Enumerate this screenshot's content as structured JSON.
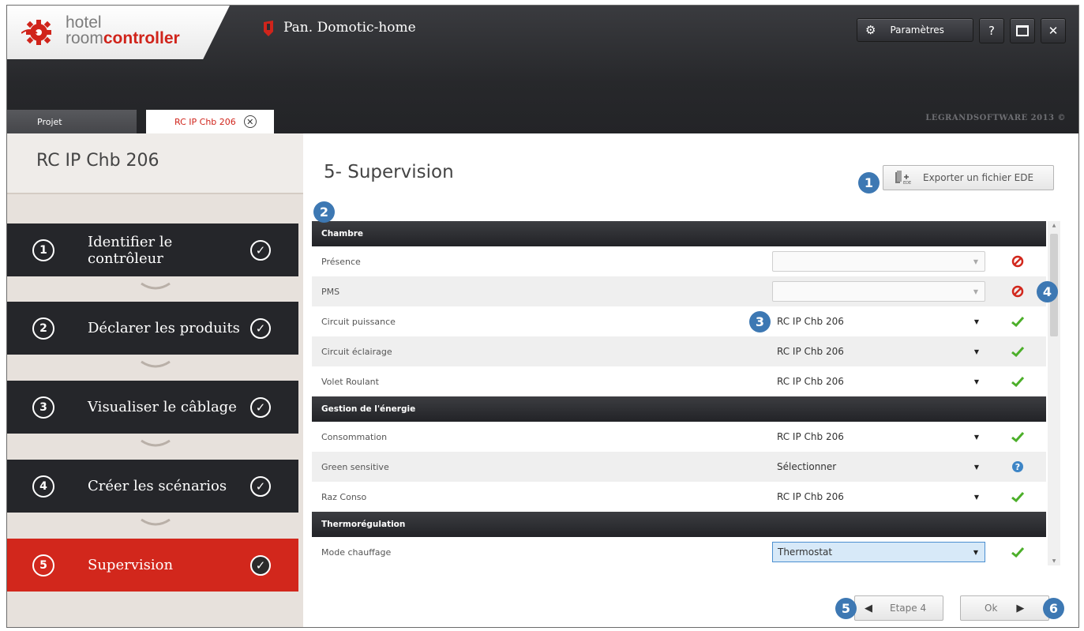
{
  "header": {
    "logo_hotel": "hotel",
    "logo_room": "room",
    "logo_controller": "controller",
    "app_title": "Pan. Domotic-home",
    "params_label": "Paramètres",
    "help_label": "?",
    "copyright": "LEGRANDSOFTWARE 2013 ©"
  },
  "tabs": [
    {
      "label": "Projet"
    },
    {
      "label": "RC IP Chb 206"
    }
  ],
  "sidebar": {
    "title": "RC IP Chb 206",
    "steps": [
      {
        "num": "1",
        "label": "Identifier le contrôleur"
      },
      {
        "num": "2",
        "label": "Déclarer les produits"
      },
      {
        "num": "3",
        "label": "Visualiser le câblage"
      },
      {
        "num": "4",
        "label": "Créer les scénarios"
      },
      {
        "num": "5",
        "label": "Supervision"
      }
    ]
  },
  "main": {
    "title": "5- Supervision",
    "export_label": "Exporter un fichier EDE",
    "sections": [
      {
        "title": "Chambre",
        "rows": [
          {
            "label": "Présence",
            "value": "",
            "status": "forbidden"
          },
          {
            "label": "PMS",
            "value": "",
            "status": "forbidden"
          },
          {
            "label": "Circuit puissance",
            "value": "RC IP Chb 206",
            "status": "ok"
          },
          {
            "label": "Circuit éclairage",
            "value": "RC IP Chb 206",
            "status": "ok"
          },
          {
            "label": "Volet Roulant",
            "value": "RC IP Chb 206",
            "status": "ok"
          }
        ]
      },
      {
        "title": "Gestion de l'énergie",
        "rows": [
          {
            "label": "Consommation",
            "value": "RC IP Chb 206",
            "status": "ok"
          },
          {
            "label": "Green sensitive",
            "value": "Sélectionner",
            "status": "help"
          },
          {
            "label": "Raz Conso",
            "value": "RC IP Chb 206",
            "status": "ok"
          }
        ]
      },
      {
        "title": "Thermorégulation",
        "rows": [
          {
            "label": "Mode chauffage",
            "value": "Thermostat",
            "status": "ok"
          }
        ]
      }
    ],
    "prev_label": "Etape 4",
    "next_label": "Ok"
  },
  "badges": [
    "1",
    "2",
    "3",
    "4",
    "5",
    "6"
  ],
  "colors": {
    "accent_red": "#d2271c",
    "badge_blue": "#3d78b3",
    "ok_green": "#4caf2a"
  }
}
